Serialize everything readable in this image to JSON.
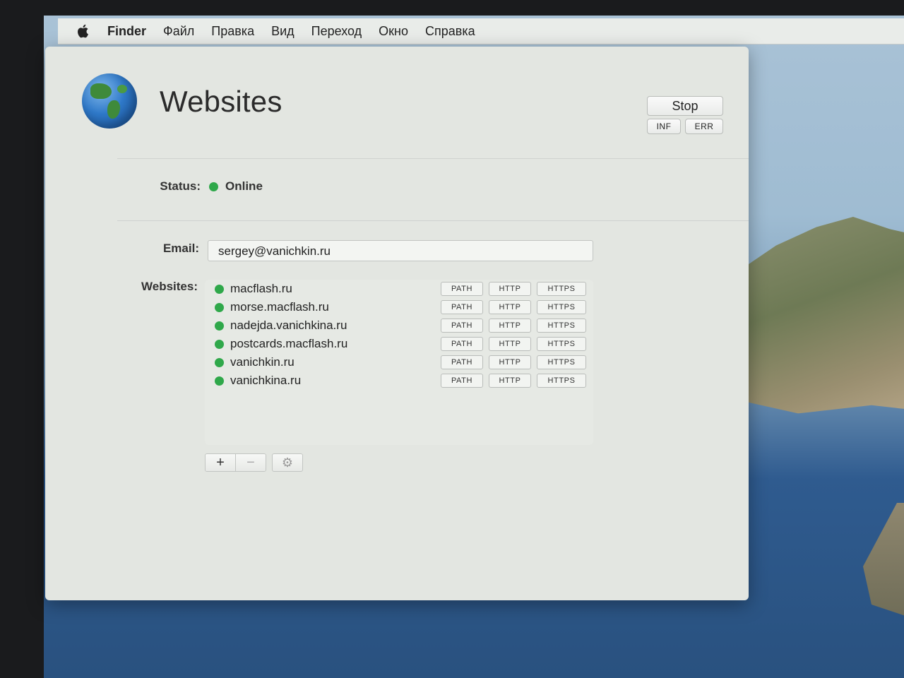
{
  "menubar": {
    "app": "Finder",
    "items": [
      "Файл",
      "Правка",
      "Вид",
      "Переход",
      "Окно",
      "Справка"
    ]
  },
  "window": {
    "title": "Websites",
    "stop_label": "Stop",
    "inf_label": "INF",
    "err_label": "ERR"
  },
  "status": {
    "label": "Status:",
    "value": "Online",
    "color": "#2fa84a"
  },
  "email": {
    "label": "Email:",
    "value": "sergey@vanichkin.ru"
  },
  "websites": {
    "label": "Websites:",
    "tag_labels": {
      "path": "PATH",
      "http": "HTTP",
      "https": "HTTPS"
    },
    "items": [
      {
        "name": "macflash.ru"
      },
      {
        "name": "morse.macflash.ru"
      },
      {
        "name": "nadejda.vanichkina.ru"
      },
      {
        "name": "postcards.macflash.ru"
      },
      {
        "name": "vanichkin.ru"
      },
      {
        "name": "vanichkina.ru"
      }
    ]
  },
  "toolbar": {
    "add_label": "+",
    "remove_label": "−",
    "settings_icon": "gear-icon"
  }
}
